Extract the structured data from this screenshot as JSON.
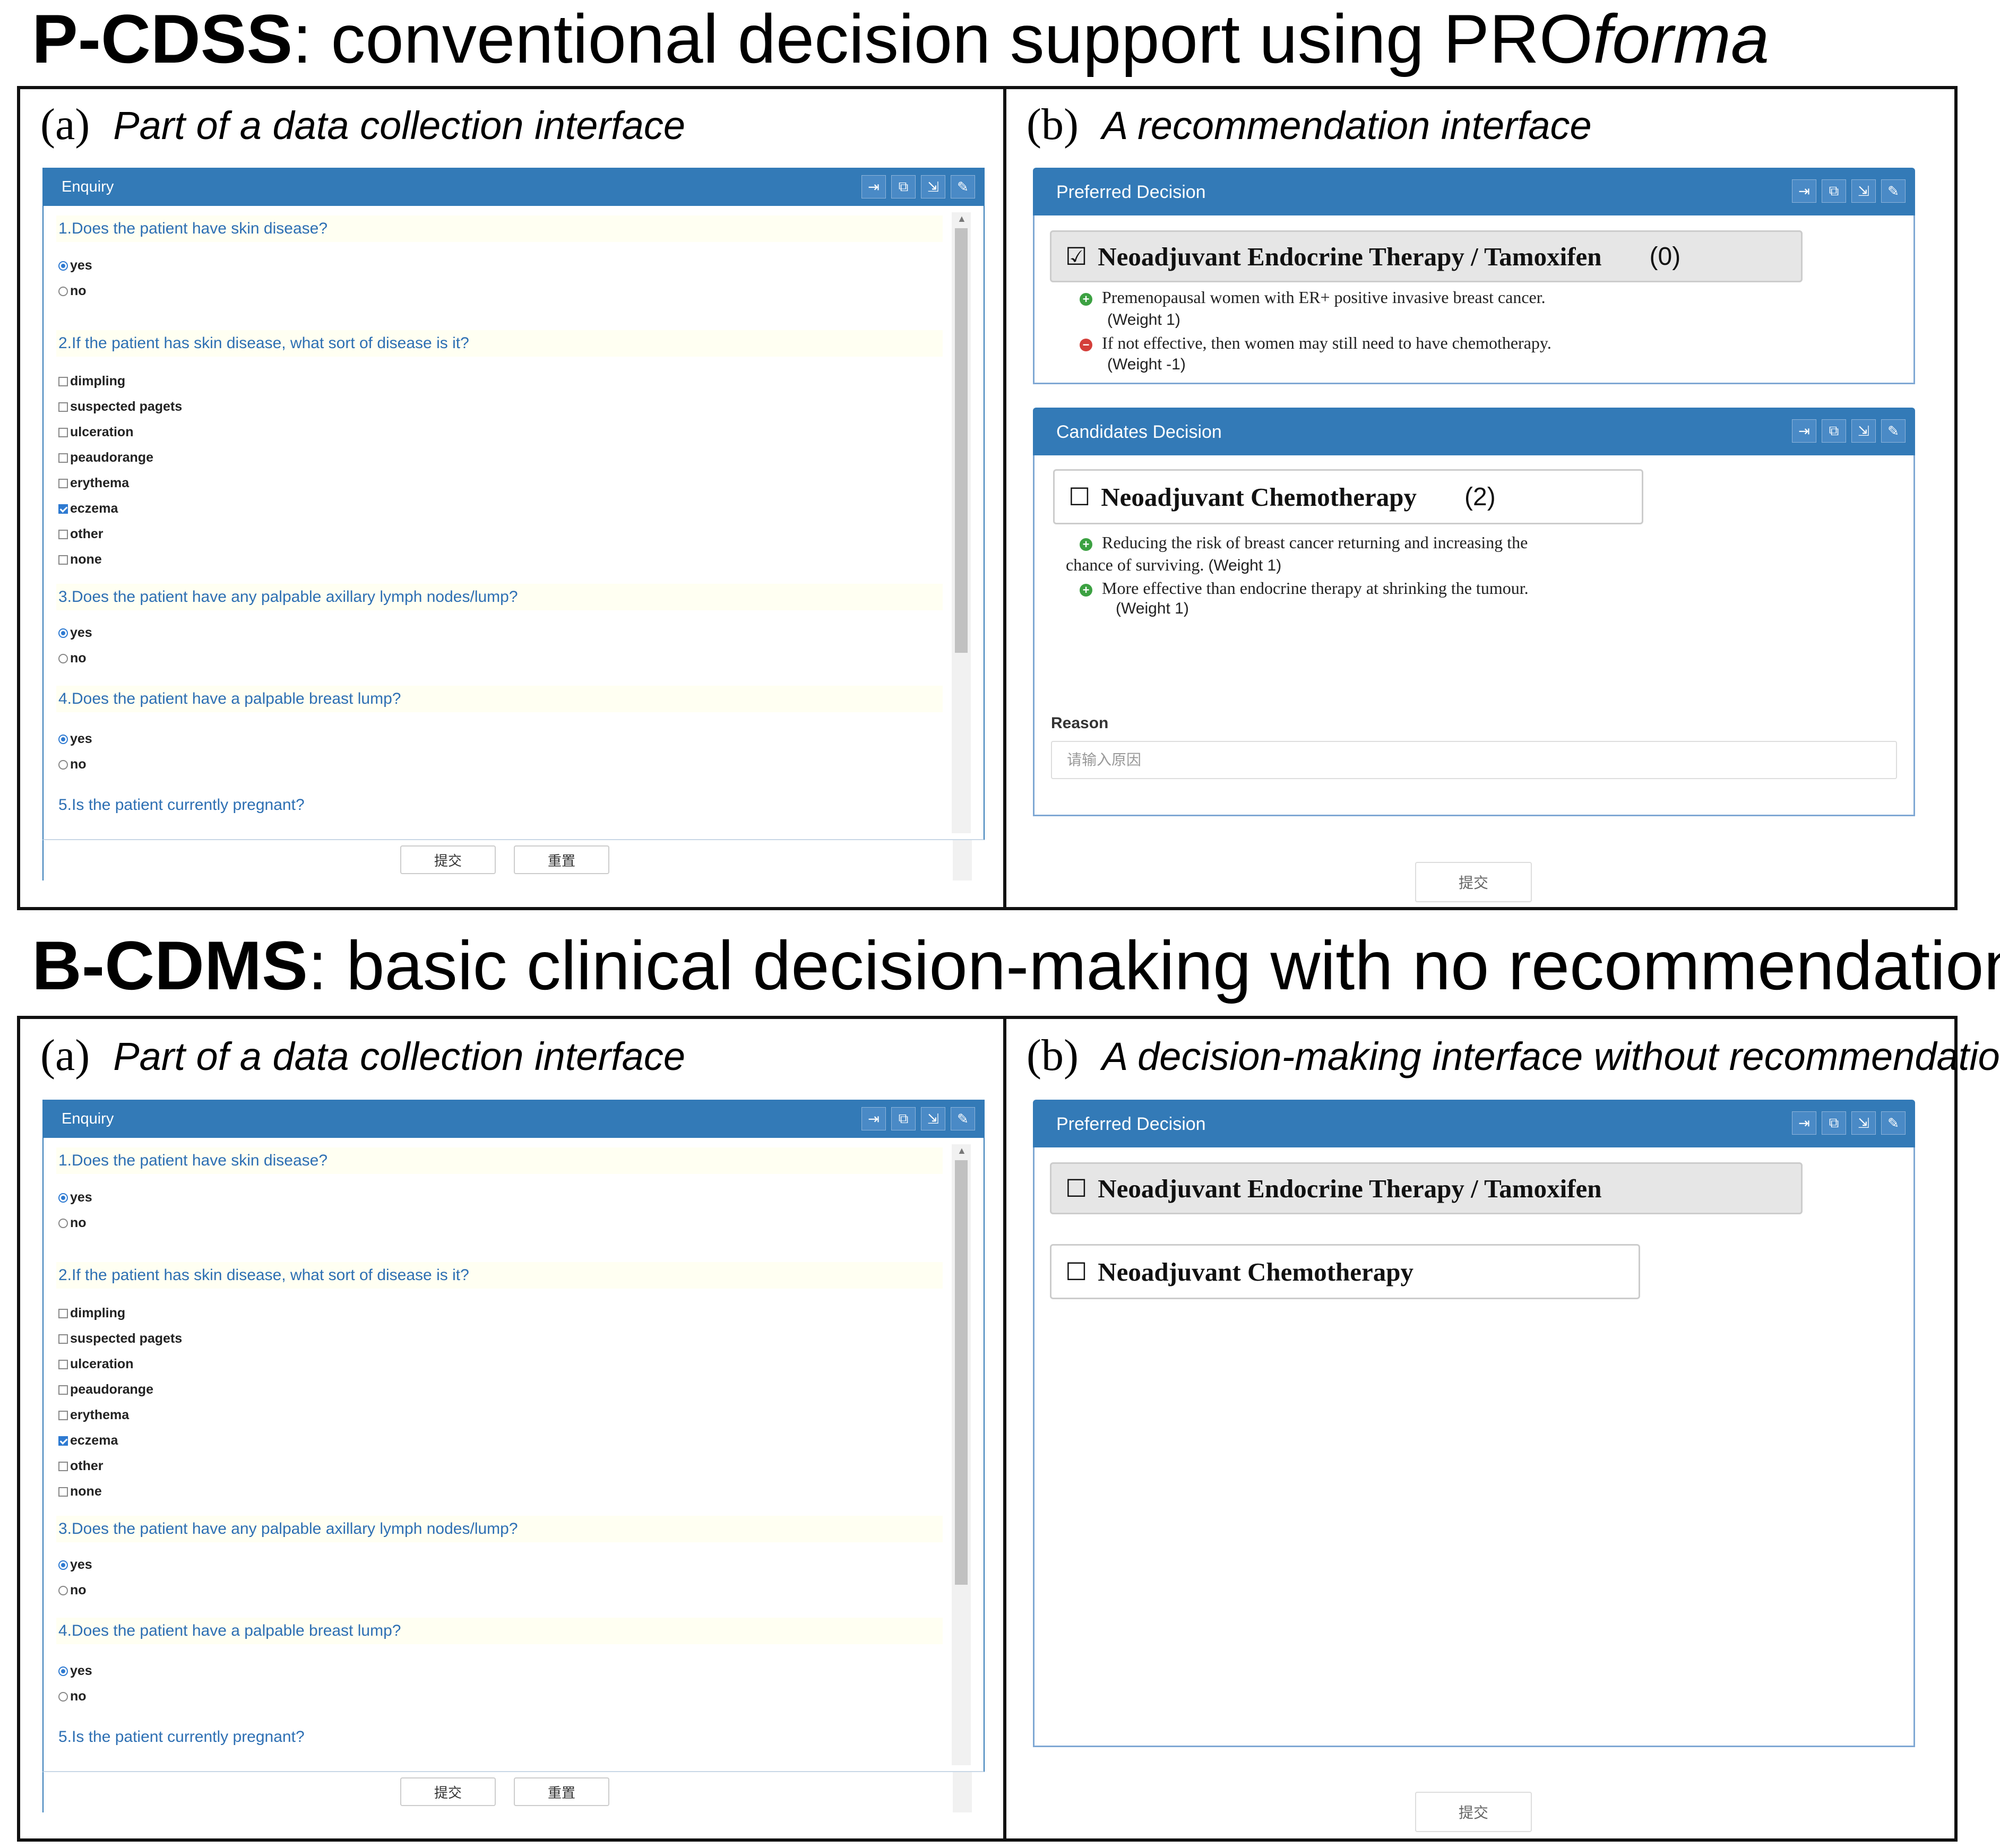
{
  "top": {
    "title_bold": "P-CDSS",
    "title_rest": ": conventional decision support using PRO",
    "title_italic": "forma",
    "left_letter": "(a)",
    "left_caption": "Part of a data collection interface",
    "right_letter": "(b)",
    "right_caption": "A recommendation interface"
  },
  "bottom": {
    "title_bold": "B-CDMS",
    "title_rest": ": basic clinical decision-making with no recommendation",
    "left_letter": "(a)",
    "left_caption": "Part of a data collection interface",
    "right_letter": "(b)",
    "right_caption": "A decision-making interface without recommendation"
  },
  "enquiry": {
    "header": "Enquiry",
    "q1": "1.Does the patient have skin disease?",
    "q2": "2.If the patient has skin disease, what sort of disease is it?",
    "q3": "3.Does the patient have any palpable axillary lymph nodes/lump?",
    "q4": "4.Does the patient have a palpable breast lump?",
    "q5": "5.Is the patient currently pregnant?",
    "yes": "yes",
    "no": "no",
    "diseases": [
      "dimpling",
      "suspected pagets",
      "ulceration",
      "peaudorange",
      "erythema",
      "eczema",
      "other",
      "none"
    ],
    "submit": "提交",
    "reset": "重置"
  },
  "recommend": {
    "preferred_header": "Preferred Decision",
    "candidates_header": "Candidates Decision",
    "checked_box": "☑",
    "unchecked_box": "☐",
    "option1": "Neoadjuvant Endocrine Therapy / Tamoxifen",
    "option1_score": "(0)",
    "option1_arg1": "Premenopausal women with ER+ positive invasive breast cancer.",
    "option1_arg1_weight": "(Weight 1)",
    "option1_arg2": "If not effective, then women may still need to have chemotherapy.",
    "option1_arg2_weight": "(Weight -1)",
    "option2": "Neoadjuvant Chemotherapy",
    "option2_score": "(2)",
    "option2_arg1a": "Reducing the risk of breast cancer returning and increasing the",
    "option2_arg1b": "chance of surviving.",
    "option2_arg1_weight": "(Weight 1)",
    "option2_arg2": "More effective than endocrine therapy at shrinking the tumour.",
    "option2_arg2_weight": "(Weight 1)",
    "reason_label": "Reason",
    "reason_placeholder": "请输入原因",
    "submit": "提交"
  },
  "icons": [
    "export-icon",
    "copy-icon",
    "signout-icon",
    "edit-icon"
  ],
  "colors": {
    "header_blue": "#337ab7",
    "question_blue": "#2d6fb3",
    "pro_green": "#3ca142",
    "con_red": "#d43f3a"
  }
}
